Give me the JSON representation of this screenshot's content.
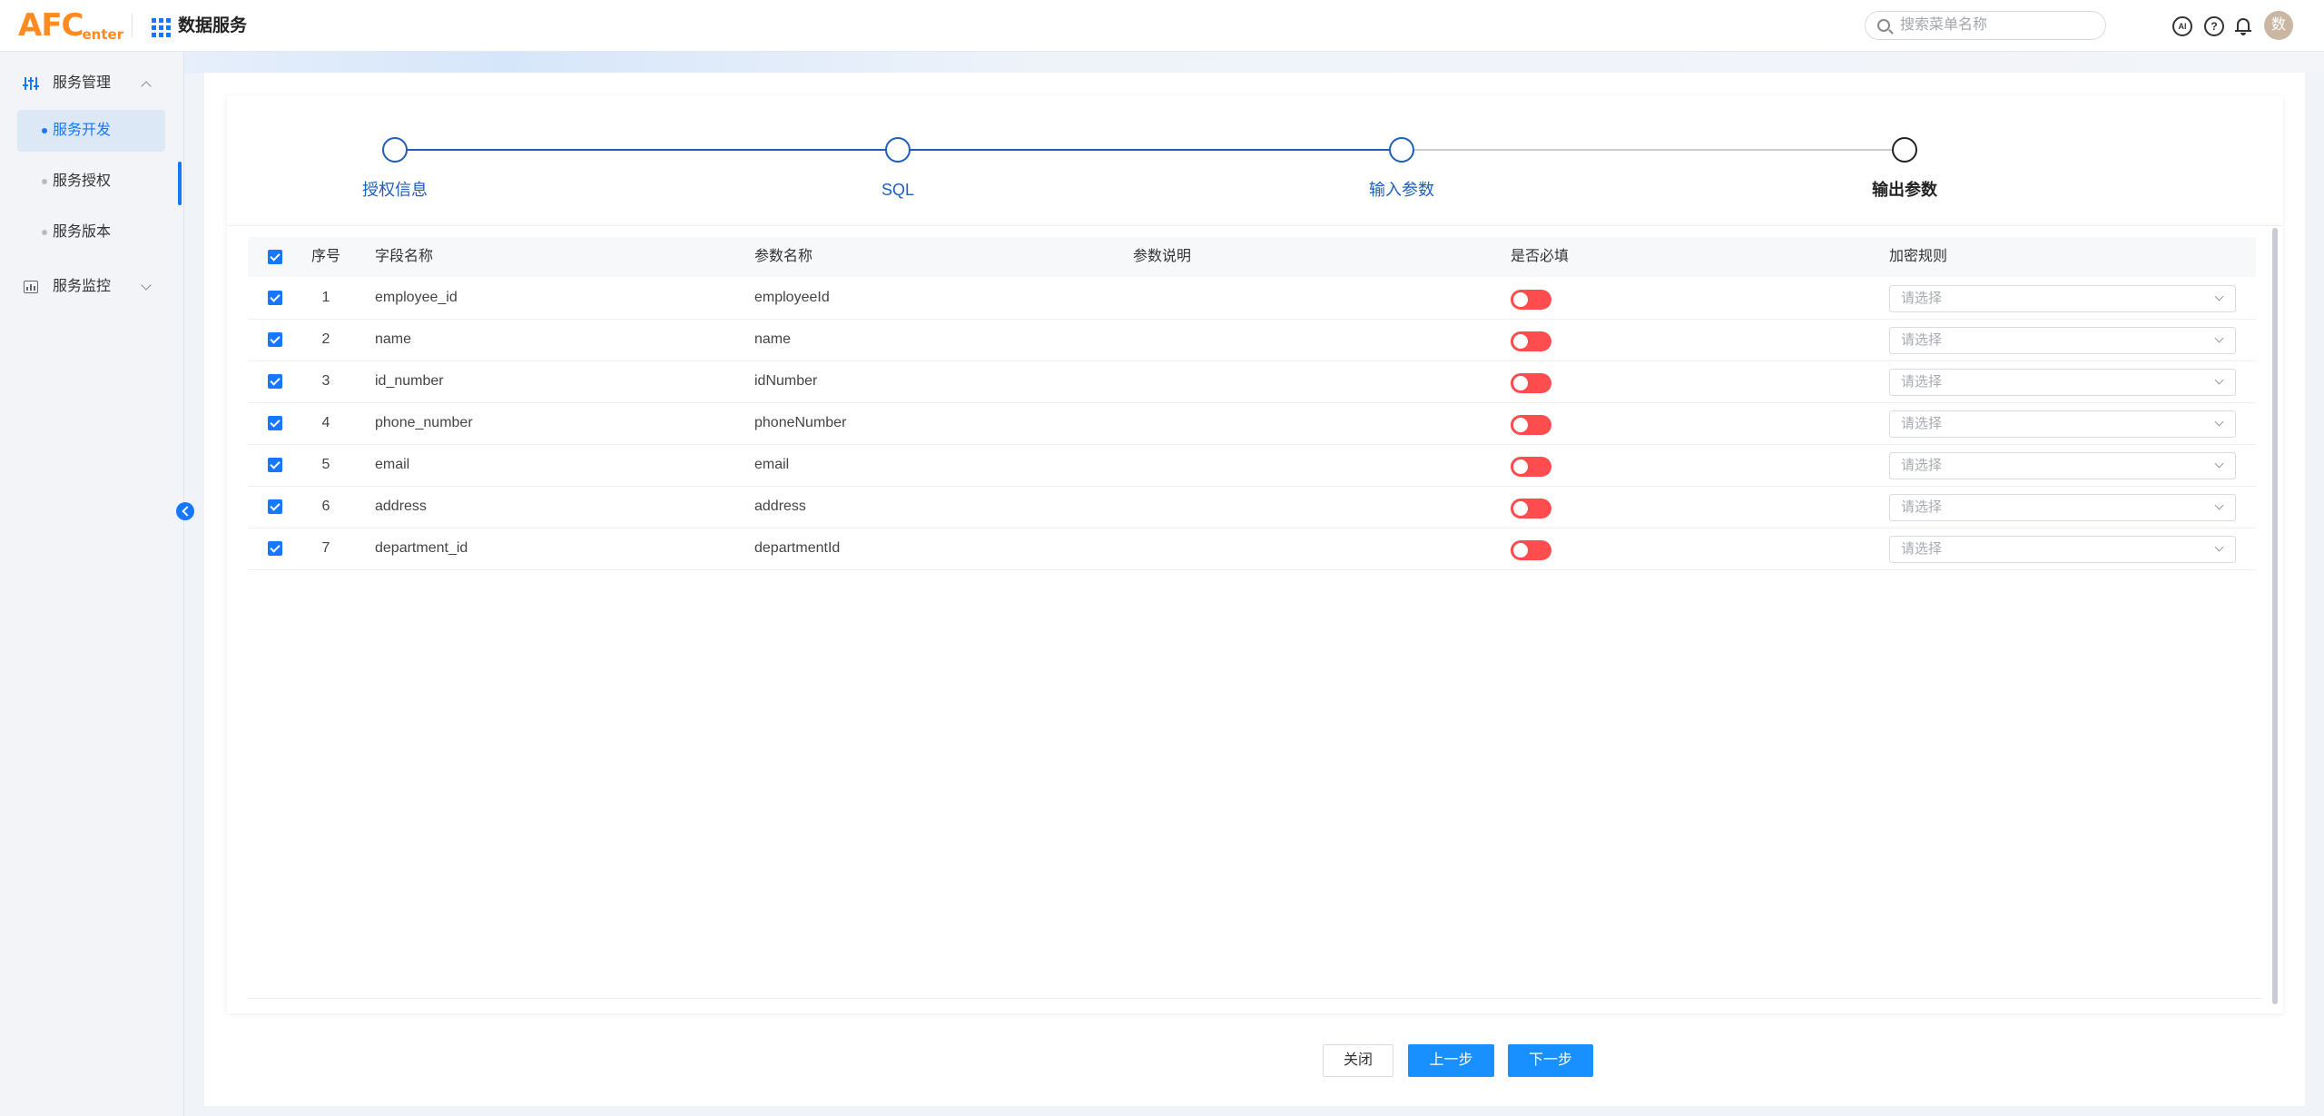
{
  "header": {
    "logo_main": "AFC",
    "logo_sub": "enter",
    "app_title": "数据服务",
    "search_placeholder": "搜索菜单名称",
    "ai_icon_text": "AI",
    "help_icon_text": "?",
    "avatar_text": "数"
  },
  "sidebar": {
    "groups": [
      {
        "label": "服务管理",
        "icon": "sliders-icon",
        "expanded": true
      },
      {
        "label": "服务监控",
        "icon": "monitor-icon",
        "expanded": false
      }
    ],
    "items": [
      {
        "label": "服务开发",
        "active": true
      },
      {
        "label": "服务授权",
        "active": false
      },
      {
        "label": "服务版本",
        "active": false
      }
    ]
  },
  "steps": [
    {
      "label": "授权信息",
      "status": "done"
    },
    {
      "label": "SQL",
      "status": "done"
    },
    {
      "label": "输入参数",
      "status": "done"
    },
    {
      "label": "输出参数",
      "status": "current"
    }
  ],
  "table": {
    "columns": {
      "no": "序号",
      "field": "字段名称",
      "param": "参数名称",
      "desc": "参数说明",
      "required": "是否必填",
      "encrypt": "加密规则"
    },
    "select_placeholder": "请选择",
    "rows": [
      {
        "no": "1",
        "field": "employee_id",
        "param": "employeeId",
        "desc": ""
      },
      {
        "no": "2",
        "field": "name",
        "param": "name",
        "desc": ""
      },
      {
        "no": "3",
        "field": "id_number",
        "param": "idNumber",
        "desc": ""
      },
      {
        "no": "4",
        "field": "phone_number",
        "param": "phoneNumber",
        "desc": ""
      },
      {
        "no": "5",
        "field": "email",
        "param": "email",
        "desc": ""
      },
      {
        "no": "6",
        "field": "address",
        "param": "address",
        "desc": ""
      },
      {
        "no": "7",
        "field": "department_id",
        "param": "departmentId",
        "desc": ""
      }
    ]
  },
  "footer": {
    "close": "关闭",
    "prev": "上一步",
    "next": "下一步"
  },
  "colors": {
    "primary": "#1677ff",
    "step_done": "#1f5fb8",
    "toggle_off": "#ff4d4f",
    "logo": "#ff8a1f"
  }
}
